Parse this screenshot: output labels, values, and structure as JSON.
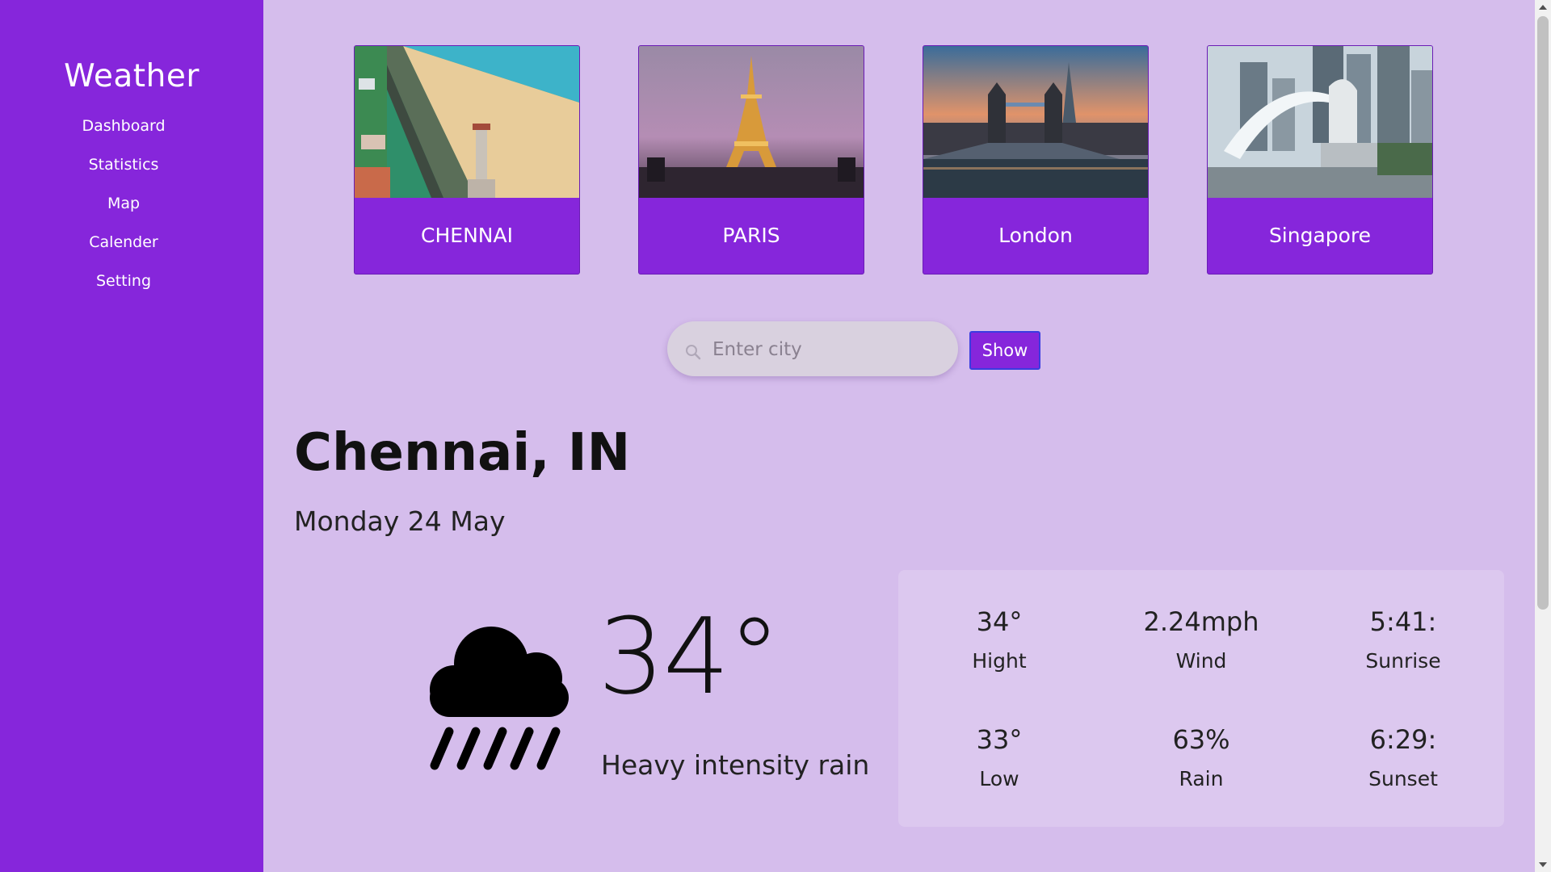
{
  "sidebar": {
    "title": "Weather",
    "items": [
      {
        "label": "Dashboard"
      },
      {
        "label": "Statistics"
      },
      {
        "label": "Map"
      },
      {
        "label": "Calender"
      },
      {
        "label": "Setting"
      }
    ]
  },
  "cards": [
    {
      "label": "CHENNAI"
    },
    {
      "label": "PARIS"
    },
    {
      "label": "London"
    },
    {
      "label": "Singapore"
    }
  ],
  "search": {
    "placeholder": "Enter city",
    "value": "",
    "button_label": "Show"
  },
  "location": {
    "city": "Chennai, IN",
    "date": "Monday 24 May"
  },
  "current": {
    "temperature": "34°",
    "condition": "Heavy intensity rain",
    "icon": "cloud-rain-icon"
  },
  "stats": [
    {
      "value": "34°",
      "label": "Hight"
    },
    {
      "value": "2.24mph",
      "label": "Wind"
    },
    {
      "value": "5:41:",
      "label": "Sunrise"
    },
    {
      "value": "33°",
      "label": "Low"
    },
    {
      "value": "63%",
      "label": "Rain"
    },
    {
      "value": "6:29:",
      "label": "Sunset"
    }
  ],
  "colors": {
    "sidebar": "#8626db",
    "background": "#d5bdec",
    "panel": "#dcc8ef",
    "button_border": "#3a3ce0"
  }
}
